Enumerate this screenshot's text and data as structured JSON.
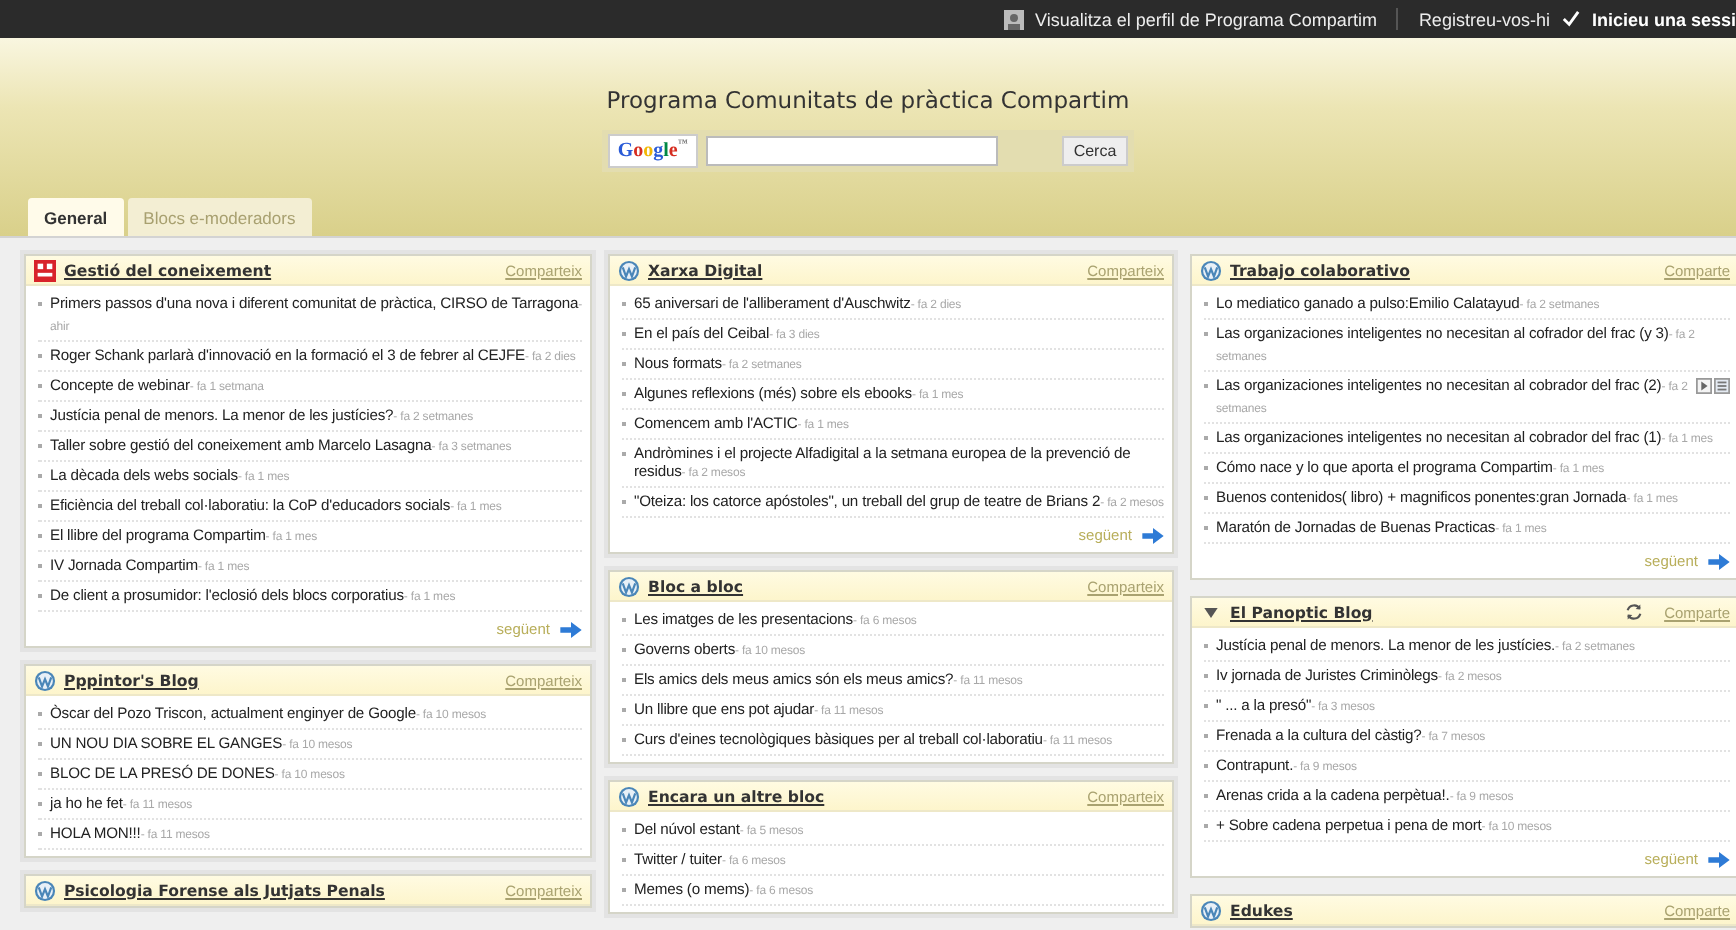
{
  "topbar": {
    "profile_link": "Visualitza el perfil de Programa Compartim",
    "register_link": "Registreu-vos-hi",
    "login_link": "Inicieu una sessi"
  },
  "header": {
    "title": "Programa Comunitats de pràctica Compartim",
    "search": {
      "logo": "Google™",
      "button": "Cerca"
    }
  },
  "tabs": [
    {
      "label": "General",
      "selected": true
    },
    {
      "label": "Blocs e-moderadors",
      "selected": false
    }
  ],
  "columns": [
    {
      "cards": [
        {
          "title": "Gestió del coneixement",
          "kind": "logo",
          "share": "Comparteix",
          "next": "següent",
          "items": [
            {
              "title": "Primers passos d'una nova i diferent comunitat de pràctica, CIRSO de Tarragona",
              "age": "- ahir"
            },
            {
              "title": "Roger Schank parlarà d'innovació en la formació el 3 de febrer al CEJFE",
              "age": "- fa 2 dies"
            },
            {
              "title": "Concepte de webinar",
              "age": "- fa 1 setmana"
            },
            {
              "title": "Justícia penal de menors. La menor de les justícies?",
              "age": "- fa 2 setmanes"
            },
            {
              "title": "Taller sobre gestió del coneixement amb Marcelo Lasagna",
              "age": "- fa 3 setmanes"
            },
            {
              "title": "La dècada dels webs socials",
              "age": "- fa 1 mes"
            },
            {
              "title": "Eficiència del treball col·laboratiu: la CoP d'educadors socials",
              "age": "- fa 1 mes"
            },
            {
              "title": "El llibre del programa Compartim",
              "age": "- fa 1 mes"
            },
            {
              "title": "IV Jornada Compartim",
              "age": "- fa 1 mes"
            },
            {
              "title": "De client a prosumidor: l'eclosió dels blocs corporatius",
              "age": "- fa 1 mes"
            }
          ]
        },
        {
          "title": "Pppintor's Blog",
          "kind": "wordpress",
          "share": "Comparteix",
          "items": [
            {
              "title": "Òscar del Pozo Triscon, actualment enginyer de Google",
              "age": "- fa 10 mesos"
            },
            {
              "title": "UN NOU DIA SOBRE EL GANGES",
              "age": "- fa 10 mesos"
            },
            {
              "title": "BLOC DE LA PRESÓ DE DONES",
              "age": "- fa 10 mesos"
            },
            {
              "title": "ja ho he fet",
              "age": "- fa 11 mesos"
            },
            {
              "title": "HOLA MON!!!",
              "age": "- fa 11 mesos"
            }
          ]
        },
        {
          "title": "Psicologia Forense als Jutjats Penals",
          "kind": "wordpress",
          "share": "Comparteix"
        }
      ]
    },
    {
      "cards": [
        {
          "title": "Xarxa Digital",
          "kind": "wordpress",
          "share": "Comparteix",
          "next": "següent",
          "items": [
            {
              "title": "65 aniversari de l'alliberament d'Auschwitz",
              "age": "- fa 2 dies"
            },
            {
              "title": "En el país del Ceibal",
              "age": "- fa 3 dies"
            },
            {
              "title": "Nous formats",
              "age": "- fa 2 setmanes"
            },
            {
              "title": "Algunes reflexions (més) sobre els ebooks",
              "age": "- fa 1 mes"
            },
            {
              "title": "Comencem amb l'ACTIC",
              "age": "- fa 1 mes"
            },
            {
              "title": "Andròmines i el projecte Alfadigital a la setmana europea de la prevenció de residus",
              "age": "- fa 2 mesos"
            },
            {
              "title": "\"Oteiza: los catorce apóstoles\", un treball del grup de teatre de Brians 2",
              "age": "- fa 2 mesos"
            }
          ]
        },
        {
          "title": "Bloc a bloc",
          "kind": "wordpress",
          "share": "Comparteix",
          "items": [
            {
              "title": "Les imatges de les presentacions",
              "age": "- fa 6 mesos"
            },
            {
              "title": "Governs oberts",
              "age": "- fa 10 mesos"
            },
            {
              "title": "Els amics dels meus amics són els meus amics?",
              "age": "- fa 11 mesos"
            },
            {
              "title": "Un llibre que ens pot ajudar",
              "age": "- fa 11 mesos"
            },
            {
              "title": "Curs d'eines tecnològiques bàsiques per al treball col·laboratiu",
              "age": "- fa 11 mesos"
            }
          ]
        },
        {
          "title": "Encara un altre bloc",
          "kind": "wordpress",
          "share": "Comparteix",
          "items": [
            {
              "title": "Del núvol estant",
              "age": "- fa 5 mesos"
            },
            {
              "title": "Twitter / tuiter",
              "age": "- fa 6 mesos"
            },
            {
              "title": "Memes (o mems)",
              "age": "- fa 6 mesos"
            }
          ]
        }
      ]
    },
    {
      "cards": [
        {
          "title": "Trabajo colaborativo",
          "kind": "wordpress",
          "share": "Comparte",
          "next": "següent",
          "items": [
            {
              "title": "Lo mediatico ganado a pulso:Emilio Calatayud",
              "age": "- fa 2 setmanes"
            },
            {
              "title": "Las organizaciones inteligentes no necesitan al cofrador del frac (y 3)",
              "age": "- fa 2 setmanes"
            },
            {
              "title": "Las organizaciones inteligentes no necesitan al cobrador del frac (2)",
              "age": "- fa 2 setmanes",
              "tools": true
            },
            {
              "title": "Las organizaciones inteligentes no necesitan al cobrador del frac (1)",
              "age": "- fa 1 mes"
            },
            {
              "title": "Cómo nace y lo que aporta el programa Compartim",
              "age": "- fa 1 mes"
            },
            {
              "title": "Buenos contenidos( libro) + magnificos ponentes:gran Jornada",
              "age": "- fa 1 mes"
            },
            {
              "title": "Maratón de Jornadas de Buenas Practicas",
              "age": "- fa 1 mes"
            }
          ]
        },
        {
          "title": "El Panoptic Blog",
          "kind": "collapsible",
          "refresh": true,
          "share": "Comparte",
          "next": "següent",
          "items": [
            {
              "title": "Justícia penal de menors. La menor de les justícies.",
              "age": "- fa 2 setmanes"
            },
            {
              "title": "Iv jornada de Juristes Criminòlegs",
              "age": "- fa 2 mesos"
            },
            {
              "title": "\" ... a la presó\"",
              "age": "- fa 3 mesos"
            },
            {
              "title": "Frenada a la cultura del càstig?",
              "age": "- fa 7 mesos"
            },
            {
              "title": "Contrapunt.",
              "age": "- fa 9 mesos"
            },
            {
              "title": "Arenas crida a la cadena perpètua!.",
              "age": "- fa 9 mesos"
            },
            {
              "title": "+ Sobre cadena perpetua i pena de mort",
              "age": "- fa 10 mesos"
            }
          ]
        },
        {
          "title": "Edukes",
          "kind": "wordpress",
          "share": "Comparte"
        }
      ]
    }
  ]
}
